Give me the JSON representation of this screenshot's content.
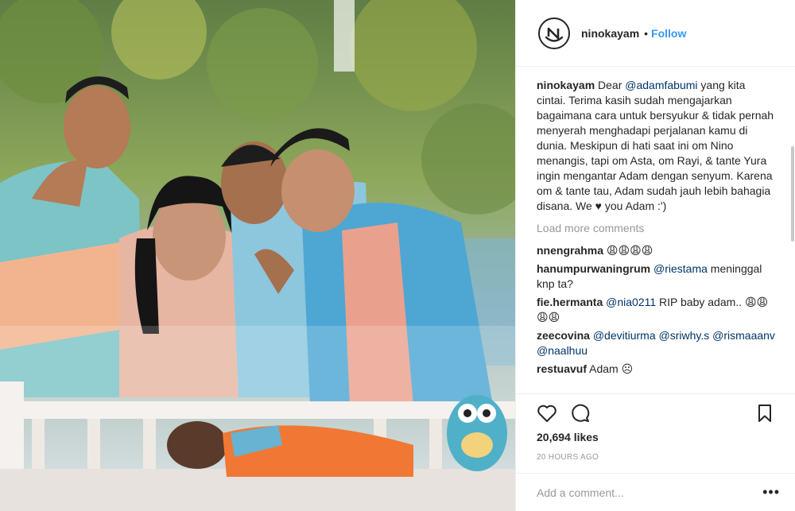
{
  "photo": {
    "alt_subject": "family looking at a baby in a crib"
  },
  "header": {
    "username": "ninokayam",
    "separator": "•",
    "follow_label": "Follow",
    "avatar_icon": "ninokayam-logo-icon"
  },
  "caption": {
    "username": "ninokayam",
    "text_1": " Dear ",
    "mention": "@adamfabumi",
    "text_2": " yang kita cintai. Terima kasih sudah mengajarkan bagaimana cara untuk bersyukur & tidak pernah menyerah menghadapi perjalanan kamu di dunia. Meskipun di hati saat ini om Nino menangis, tapi om Asta, om Rayi, & tante Yura ingin mengantar Adam dengan senyum. Karena om & tante tau, Adam sudah jauh lebih bahagia disana. We ♥ you Adam :')"
  },
  "load_more": "Load more comments",
  "comments": [
    {
      "username": "nnengrahma",
      "parts": [
        {
          "t": " 😩😩😩😩",
          "m": false
        }
      ]
    },
    {
      "username": "hanumpurwaningrum",
      "parts": [
        {
          "t": " ",
          "m": false
        },
        {
          "t": "@riestama",
          "m": true
        },
        {
          "t": " meninggal knp ta?",
          "m": false
        }
      ]
    },
    {
      "username": "fie.hermanta",
      "parts": [
        {
          "t": " ",
          "m": false
        },
        {
          "t": "@nia0211",
          "m": true
        },
        {
          "t": " RIP baby adam.. 😩😩😩😩",
          "m": false
        }
      ]
    },
    {
      "username": "zeecovina",
      "parts": [
        {
          "t": " ",
          "m": false
        },
        {
          "t": "@devitiurma",
          "m": true
        },
        {
          "t": " ",
          "m": false
        },
        {
          "t": "@sriwhy.s",
          "m": true
        },
        {
          "t": " ",
          "m": false
        },
        {
          "t": "@rismaaanv",
          "m": true
        },
        {
          "t": " ",
          "m": false
        },
        {
          "t": "@naalhuu",
          "m": true
        }
      ]
    },
    {
      "username": "restuavuf",
      "parts": [
        {
          "t": " Adam ☹",
          "m": false
        }
      ]
    }
  ],
  "actions": {
    "like_icon": "heart-icon",
    "comment_icon": "comment-icon",
    "save_icon": "bookmark-icon"
  },
  "likes": "20,694 likes",
  "timestamp": "20 HOURS AGO",
  "add_comment": {
    "placeholder": "Add a comment...",
    "more_label": "•••"
  },
  "colors": {
    "link": "#3897f0",
    "mention": "#003569",
    "muted": "#999999"
  }
}
